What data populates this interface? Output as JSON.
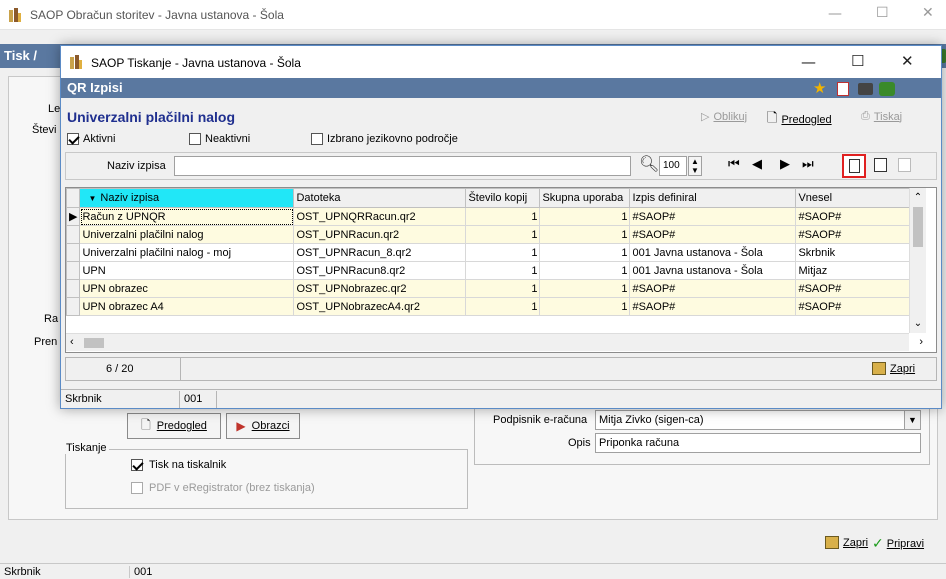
{
  "back_window": {
    "title": "SAOP Obračun storitev - Javna ustanova - Šola",
    "header": "Tisk /",
    "left_labels": [
      "Le",
      "Števi",
      "Ra",
      "Pren"
    ],
    "preview_button": "Predogled",
    "forms_button": "Obrazci",
    "print_group": {
      "legend": "Tiskanje",
      "print_to_printer": "Tisk na tiskalnik",
      "pdf_eregistrator": "PDF v eRegistrator (brez tiskanja)"
    },
    "signer": {
      "label": "Podpisnik e-računa",
      "value": "Mitja Zivko (sigen-ca)"
    },
    "description": {
      "label": "Opis",
      "value": "Priponka računa"
    },
    "close_button": "Zapri",
    "prepare_button": "Pripravi",
    "status": {
      "user": "Skrbnik",
      "code": "001"
    }
  },
  "dialog": {
    "title": "SAOP Tiskanje - Javna ustanova - Šola",
    "header": "QR Izpisi",
    "form_title": "Univerzalni plačilni nalog",
    "toolbar": {
      "design": "Oblikuj",
      "preview": "Predogled",
      "print": "Tiskaj"
    },
    "filters": {
      "active": "Aktivni",
      "inactive": "Neaktivni",
      "language": "Izbrano jezikovno področje"
    },
    "search": {
      "label": "Naziv izpisa",
      "value": "",
      "page_size": "100"
    },
    "columns": [
      "Naziv izpisa",
      "Datoteka",
      "Število kopij",
      "Skupna uporaba",
      "Izpis definiral",
      "Vnesel"
    ],
    "rows": [
      {
        "naziv": "Račun z UPNQR",
        "datoteka": "OST_UPNQRRacun.qr2",
        "kopij": "1",
        "skupna": "1",
        "definiral": "#SAOP#",
        "vnesel": "#SAOP#"
      },
      {
        "naziv": "Univerzalni plačilni nalog",
        "datoteka": "OST_UPNRacun.qr2",
        "kopij": "1",
        "skupna": "1",
        "definiral": "#SAOP#",
        "vnesel": "#SAOP#"
      },
      {
        "naziv": "Univerzalni plačilni nalog - moj",
        "datoteka": "OST_UPNRacun_8.qr2",
        "kopij": "1",
        "skupna": "1",
        "definiral": "001 Javna ustanova - Šola",
        "vnesel": "Skrbnik"
      },
      {
        "naziv": "UPN",
        "datoteka": "OST_UPNRacun8.qr2",
        "kopij": "1",
        "skupna": "1",
        "definiral": "001 Javna ustanova - Šola",
        "vnesel": "Mitjaz"
      },
      {
        "naziv": "UPN obrazec",
        "datoteka": "OST_UPNobrazec.qr2",
        "kopij": "1",
        "skupna": "1",
        "definiral": "#SAOP#",
        "vnesel": "#SAOP#"
      },
      {
        "naziv": "UPN obrazec A4",
        "datoteka": "OST_UPNobrazecA4.qr2",
        "kopij": "1",
        "skupna": "1",
        "definiral": "#SAOP#",
        "vnesel": "#SAOP#"
      }
    ],
    "pager": "6 / 20",
    "close_button": "Zapri",
    "status": {
      "user": "Skrbnik",
      "code": "001"
    }
  },
  "colors": {
    "header_blue": "#5a78a0",
    "title_blue": "#1f2f8f",
    "row_yellow": "#fefbe0",
    "sorted_cyan": "#21e7f7",
    "highlight_red": "#e02020"
  }
}
